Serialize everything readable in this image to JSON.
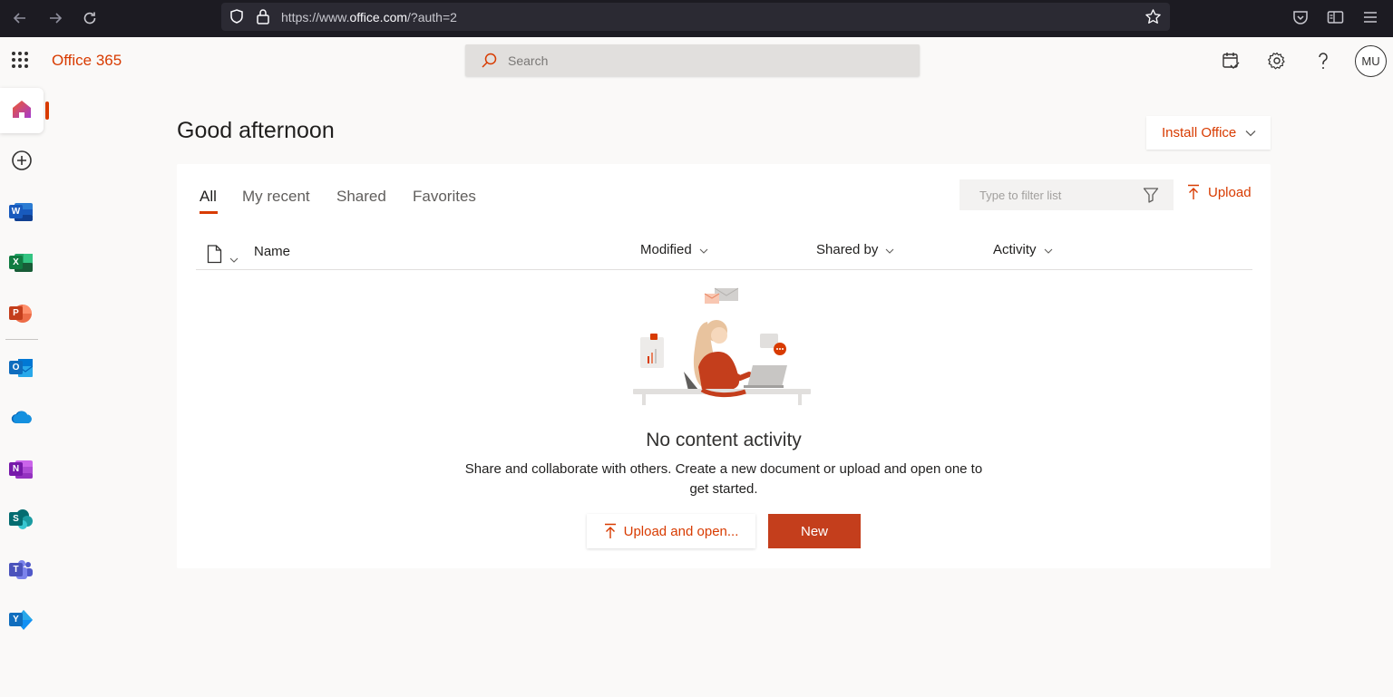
{
  "browser": {
    "url_prefix": "https://www.",
    "url_domain": "office.com",
    "url_suffix": "/?auth=2"
  },
  "header": {
    "brand": "Office 365",
    "search_placeholder": "Search",
    "avatar_initials": "MU"
  },
  "rail": {
    "apps": [
      {
        "name": "home",
        "letter": ""
      },
      {
        "name": "create",
        "letter": ""
      },
      {
        "name": "word",
        "letter": "W"
      },
      {
        "name": "excel",
        "letter": "X"
      },
      {
        "name": "powerpoint",
        "letter": "P"
      },
      {
        "name": "outlook",
        "letter": "O"
      },
      {
        "name": "onedrive",
        "letter": ""
      },
      {
        "name": "onenote",
        "letter": "N"
      },
      {
        "name": "sharepoint",
        "letter": "S"
      },
      {
        "name": "teams",
        "letter": "T"
      },
      {
        "name": "yammer",
        "letter": "Y"
      }
    ]
  },
  "main": {
    "greeting": "Good afternoon",
    "install_label": "Install Office",
    "tabs": [
      "All",
      "My recent",
      "Shared",
      "Favorites"
    ],
    "filter_placeholder": "Type to filter list",
    "upload_label": "Upload",
    "columns": {
      "name": "Name",
      "modified": "Modified",
      "shared_by": "Shared by",
      "activity": "Activity"
    },
    "empty_title": "No content activity",
    "empty_desc": "Share and collaborate with others. Create a new document or upload and open one to get started.",
    "upload_open_label": "Upload and open...",
    "new_label": "New"
  },
  "colors": {
    "accent": "#d83b01",
    "new_button": "#c43e1c",
    "word": "#185abd",
    "excel": "#107c41",
    "powerpoint": "#c43e1c",
    "outlook": "#0f6cbd",
    "onedrive": "#0364b8",
    "onenote": "#7719aa",
    "sharepoint": "#036c70",
    "teams": "#4b53bc",
    "yammer": "#106ebe"
  }
}
